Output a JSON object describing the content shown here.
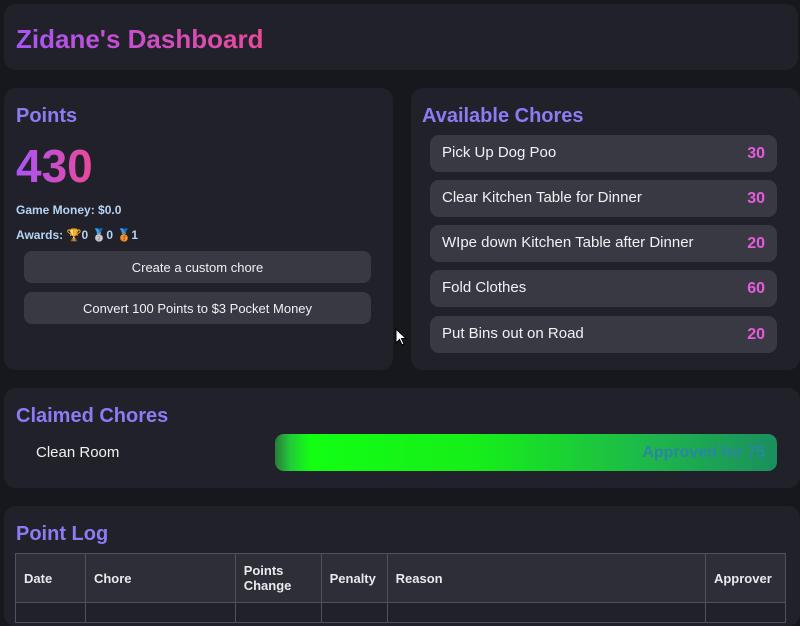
{
  "header": {
    "title": "Zidane's Dashboard"
  },
  "points": {
    "title": "Points",
    "value": "430",
    "game_money": "Game Money: $0.0",
    "awards_label": "Awards:",
    "awards": [
      {
        "icon": "trophy-icon",
        "glyph": "🏆",
        "count": "0"
      },
      {
        "icon": "silver-medal-icon",
        "glyph": "🥈",
        "count": "0"
      },
      {
        "icon": "bronze-medal-icon",
        "glyph": "🥉",
        "count": "1"
      }
    ],
    "create_button": "Create a custom chore",
    "convert_button": "Convert 100 Points to $3 Pocket Money"
  },
  "available_chores": {
    "title": "Available Chores",
    "items": [
      {
        "name": "Pick Up Dog Poo",
        "points": "30"
      },
      {
        "name": "Clear Kitchen Table for Dinner",
        "points": "30"
      },
      {
        "name": "WIpe down Kitchen Table after Dinner",
        "points": "20"
      },
      {
        "name": "Fold Clothes",
        "points": "60"
      },
      {
        "name": "Put Bins out on Road",
        "points": "20"
      }
    ]
  },
  "claimed_chores": {
    "title": "Claimed Chores",
    "items": [
      {
        "name": "Clean Room",
        "status": "Approved for 75"
      }
    ]
  },
  "point_log": {
    "title": "Point Log",
    "columns": [
      "Date",
      "Chore",
      "Points Change",
      "Penalty",
      "Reason",
      "Approver"
    ]
  },
  "colors": {
    "accent_purple": "#8b7cf6",
    "points_pink": "#e85bdc",
    "approved_green": "#12ff12"
  }
}
